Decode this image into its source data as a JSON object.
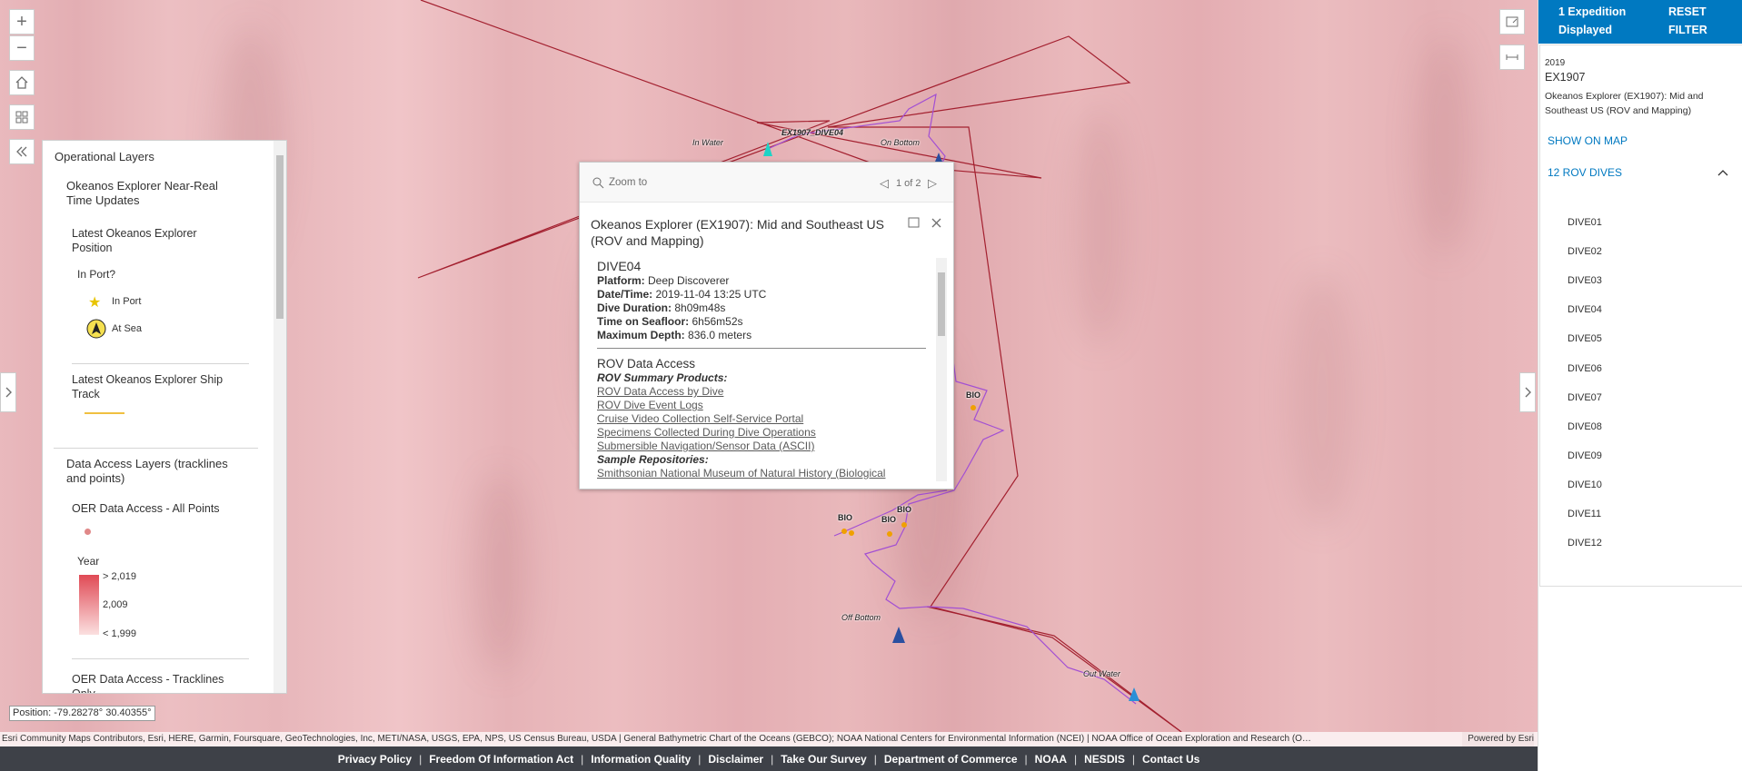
{
  "map": {
    "labels": {
      "in_water": "In Water",
      "on_bottom": "On Bottom",
      "dive_tag": "EX1907_DIVE04",
      "off_bottom": "Off Bottom",
      "out_water": "Out Water",
      "bio": "BIO"
    },
    "colors": {
      "ship_track": "#a3202f",
      "rov_track": "#a24fd3",
      "bio_point": "#f0a000",
      "marker": "#1f7bd6"
    }
  },
  "controls": {
    "zoom_in": "+",
    "zoom_out": "−",
    "home_icon": "home-icon",
    "basemap_icon": "basemap-gallery-icon",
    "collapse_icon": "double-chevron-left-icon",
    "right_top_icon": "expand-icon",
    "right_second_icon": "measure-icon",
    "left_edge_icon": "chevron-right-icon",
    "right_edge_icon": "chevron-right-icon"
  },
  "layers": {
    "title": "Operational Layers",
    "group1": "Okeanos Explorer Near-Real Time Updates",
    "position_layer": "Latest Okeanos Explorer Position",
    "in_port_q": "In Port?",
    "legend_in_port": "In Port",
    "legend_at_sea": "At Sea",
    "ship_track_layer": "Latest Okeanos Explorer Ship Track",
    "group2": "Data Access Layers (tracklines and points)",
    "all_points_layer": "OER Data Access - All Points",
    "year_label": "Year",
    "year_high": "> 2,019",
    "year_mid": "2,009",
    "year_low": "< 1,999",
    "tracklines_layer": "OER Data Access - Tracklines Only"
  },
  "popup": {
    "zoom_to": "Zoom to",
    "pager": "1 of 2",
    "title": "Okeanos Explorer (EX1907): Mid and Southeast US (ROV and Mapping)",
    "dive": "DIVE04",
    "fields": [
      {
        "label": "Platform:",
        "value": "Deep Discoverer"
      },
      {
        "label": "Date/Time:",
        "value": "2019-11-04 13:25 UTC"
      },
      {
        "label": "Dive Duration:",
        "value": "8h09m48s"
      },
      {
        "label": "Time on Seafloor:",
        "value": "6h56m52s"
      },
      {
        "label": "Maximum Depth:",
        "value": "836.0 meters"
      }
    ],
    "rov_heading": "ROV Data Access",
    "summary_label": "ROV Summary Products:",
    "links": [
      "ROV Data Access by Dive",
      "ROV Dive Event Logs",
      "Cruise Video Collection Self-Service Portal",
      "Specimens Collected During Dive Operations",
      "Submersible Navigation/Sensor Data (ASCII)"
    ],
    "sample_label": "Sample Repositories:",
    "sample_link": "Smithsonian National Museum of Natural History (Biological"
  },
  "side": {
    "count": "1 Expedition Displayed",
    "reset": "RESET FILTER",
    "year": "2019",
    "expedition": "EX1907",
    "desc": "Okeanos Explorer (EX1907): Mid and Southeast US (ROV and Mapping)",
    "show_on_map": "SHOW ON MAP",
    "rov_dives": "12 ROV DIVES",
    "dives": [
      "DIVE01",
      "DIVE02",
      "DIVE03",
      "DIVE04",
      "DIVE05",
      "DIVE06",
      "DIVE07",
      "DIVE08",
      "DIVE09",
      "DIVE10",
      "DIVE11",
      "DIVE12"
    ]
  },
  "coords": "Position: -79.28278° 30.40355°",
  "attribution": "Esri Community Maps Contributors, Esri, HERE, Garmin, Foursquare, GeoTechnologies, Inc, METI/NASA, USGS, EPA, NPS, US Census Bureau, USDA | General Bathymetric Chart of the Oceans (GEBCO); NOAA National Centers for Environmental Information (NCEI) | NOAA Office of Ocean Exploration and Research (O…",
  "powered_by": "Powered by Esri",
  "footer": [
    "Privacy Policy",
    "Freedom Of Information Act",
    "Information Quality",
    "Disclaimer",
    "Take Our Survey",
    "Department of Commerce",
    "NOAA",
    "NESDIS",
    "Contact Us"
  ]
}
